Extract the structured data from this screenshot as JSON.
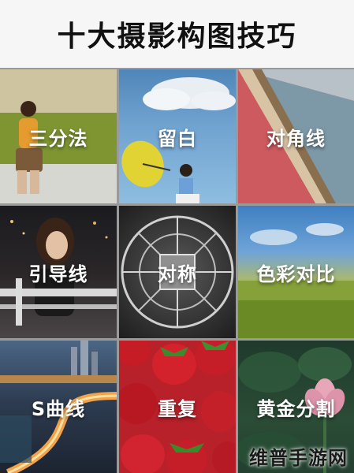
{
  "header": {
    "title": "十大摄影构图技巧"
  },
  "tiles": [
    {
      "label": "三分法",
      "image": "person-in-wheat-field"
    },
    {
      "label": "留白",
      "image": "girl-with-umbrella-sky"
    },
    {
      "label": "对角线",
      "image": "diagonal-shore"
    },
    {
      "label": "引导线",
      "image": "woman-night-city"
    },
    {
      "label": "对称",
      "image": "ferris-wheel"
    },
    {
      "label": "色彩对比",
      "image": "sky-and-field"
    },
    {
      "label": "S曲线",
      "image": "curved-road-city"
    },
    {
      "label": "重复",
      "image": "strawberries"
    },
    {
      "label": "黄金分割",
      "image": "lotus-flower"
    }
  ],
  "watermark": {
    "text": "维普手游网"
  },
  "colors": {
    "page_bg": "#f3f3f3",
    "grid_gap": "#9a9a9a",
    "title": "#111111",
    "label": "#ffffff"
  }
}
